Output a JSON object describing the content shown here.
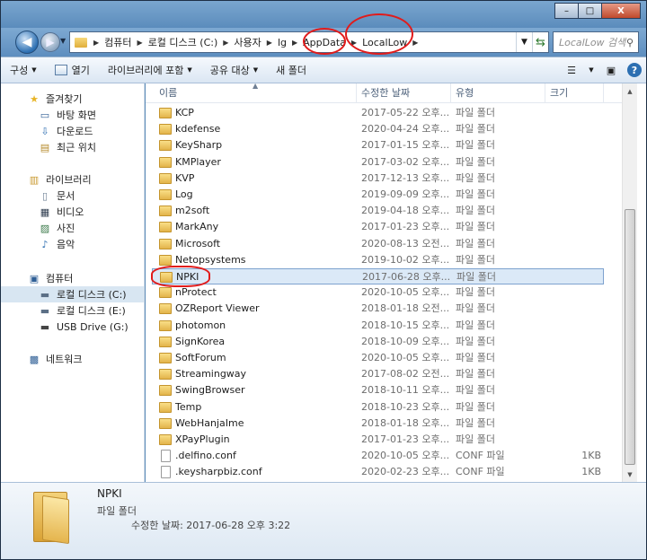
{
  "window": {
    "controls": {
      "minimize": "–",
      "maximize": "□",
      "close": "X"
    }
  },
  "nav": {
    "back_icon": "arrow-left-icon",
    "forward_icon": "arrow-right-icon",
    "breadcrumbs": [
      "컴퓨터",
      "로컬 디스크 (C:)",
      "사용자",
      "lg",
      "AppData",
      "LocalLow"
    ],
    "search_placeholder": "LocalLow 검색"
  },
  "toolbar": {
    "organize": "구성",
    "open": "열기",
    "include_library": "라이브러리에 포함",
    "share": "공유 대상",
    "new_folder": "새 폴더"
  },
  "sidebar": {
    "favorites": {
      "label": "즐겨찾기",
      "items": [
        "바탕 화면",
        "다운로드",
        "최근 위치"
      ]
    },
    "libraries": {
      "label": "라이브러리",
      "items": [
        "문서",
        "비디오",
        "사진",
        "음악"
      ]
    },
    "computer": {
      "label": "컴퓨터",
      "items": [
        "로컬 디스크 (C:)",
        "로컬 디스크 (E:)",
        "USB Drive (G:)"
      ]
    },
    "network": {
      "label": "네트워크"
    }
  },
  "columns": {
    "name": "이름",
    "date": "수정한 날짜",
    "type": "유형",
    "size": "크기"
  },
  "files": [
    {
      "name": "KCP",
      "date": "2017-05-22 오후...",
      "type": "파일 폴더",
      "size": "",
      "kind": "folder"
    },
    {
      "name": "kdefense",
      "date": "2020-04-24 오후...",
      "type": "파일 폴더",
      "size": "",
      "kind": "folder"
    },
    {
      "name": "KeySharp",
      "date": "2017-01-15 오후...",
      "type": "파일 폴더",
      "size": "",
      "kind": "folder"
    },
    {
      "name": "KMPlayer",
      "date": "2017-03-02 오후...",
      "type": "파일 폴더",
      "size": "",
      "kind": "folder"
    },
    {
      "name": "KVP",
      "date": "2017-12-13 오후...",
      "type": "파일 폴더",
      "size": "",
      "kind": "folder"
    },
    {
      "name": "Log",
      "date": "2019-09-09 오후...",
      "type": "파일 폴더",
      "size": "",
      "kind": "folder"
    },
    {
      "name": "m2soft",
      "date": "2019-04-18 오후...",
      "type": "파일 폴더",
      "size": "",
      "kind": "folder"
    },
    {
      "name": "MarkAny",
      "date": "2017-01-23 오후...",
      "type": "파일 폴더",
      "size": "",
      "kind": "folder"
    },
    {
      "name": "Microsoft",
      "date": "2020-08-13 오전...",
      "type": "파일 폴더",
      "size": "",
      "kind": "folder"
    },
    {
      "name": "Netopsystems",
      "date": "2019-10-02 오후...",
      "type": "파일 폴더",
      "size": "",
      "kind": "folder"
    },
    {
      "name": "NPKI",
      "date": "2017-06-28 오후...",
      "type": "파일 폴더",
      "size": "",
      "kind": "folder"
    },
    {
      "name": "nProtect",
      "date": "2020-10-05 오후...",
      "type": "파일 폴더",
      "size": "",
      "kind": "folder"
    },
    {
      "name": "OZReport Viewer",
      "date": "2018-01-18 오전...",
      "type": "파일 폴더",
      "size": "",
      "kind": "folder"
    },
    {
      "name": "photomon",
      "date": "2018-10-15 오후...",
      "type": "파일 폴더",
      "size": "",
      "kind": "folder"
    },
    {
      "name": "SignKorea",
      "date": "2018-10-09 오후...",
      "type": "파일 폴더",
      "size": "",
      "kind": "folder"
    },
    {
      "name": "SoftForum",
      "date": "2020-10-05 오후...",
      "type": "파일 폴더",
      "size": "",
      "kind": "folder"
    },
    {
      "name": "Streamingway",
      "date": "2017-08-02 오전...",
      "type": "파일 폴더",
      "size": "",
      "kind": "folder"
    },
    {
      "name": "SwingBrowser",
      "date": "2018-10-11 오후...",
      "type": "파일 폴더",
      "size": "",
      "kind": "folder"
    },
    {
      "name": "Temp",
      "date": "2018-10-23 오후...",
      "type": "파일 폴더",
      "size": "",
      "kind": "folder"
    },
    {
      "name": "WebHanjaIme",
      "date": "2018-01-18 오후...",
      "type": "파일 폴더",
      "size": "",
      "kind": "folder"
    },
    {
      "name": "XPayPlugin",
      "date": "2017-01-23 오후...",
      "type": "파일 폴더",
      "size": "",
      "kind": "folder"
    },
    {
      "name": ".delfino.conf",
      "date": "2020-10-05 오후...",
      "type": "CONF 파일",
      "size": "1KB",
      "kind": "file"
    },
    {
      "name": ".keysharpbiz.conf",
      "date": "2020-02-23 오후...",
      "type": "CONF 파일",
      "size": "1KB",
      "kind": "file"
    }
  ],
  "selected_index": 10,
  "details": {
    "name": "NPKI",
    "type": "파일 폴더",
    "modified": "수정한 날짜: 2017-06-28 오후 3:22"
  }
}
